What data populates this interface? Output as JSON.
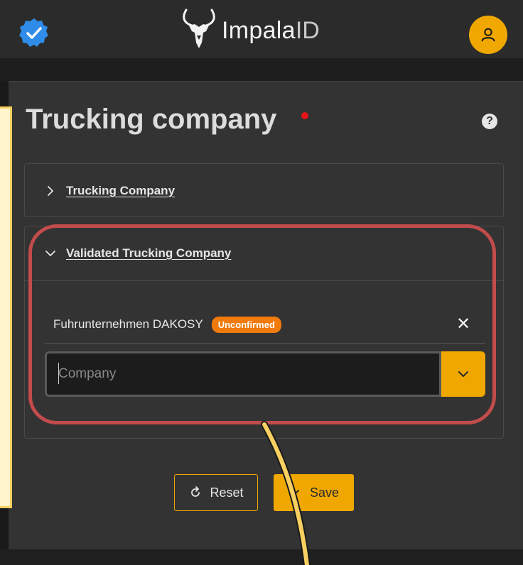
{
  "header": {
    "brand_name": "Impala",
    "brand_suffix": "ID",
    "verified_icon": "check-badge-icon",
    "avatar_icon": "user-icon"
  },
  "page": {
    "title": "Trucking company",
    "help_icon_glyph": "?"
  },
  "sections": [
    {
      "title": "Trucking Company",
      "expanded": false
    },
    {
      "title": "Validated Trucking Company",
      "expanded": true
    }
  ],
  "validated": {
    "tag_text": "Fuhrunternehmen DAKOSY",
    "badge": "Unconfirmed",
    "remove_glyph": "✕",
    "company_placeholder": "Company",
    "company_value": ""
  },
  "actions": {
    "reset_label": "Reset",
    "save_label": "Save"
  },
  "colors": {
    "accent": "#f0a800",
    "badge": "#f07a0c",
    "required": "#e8141a",
    "highlight_ring": "#c24b4b",
    "annotation": "#f7d061"
  }
}
